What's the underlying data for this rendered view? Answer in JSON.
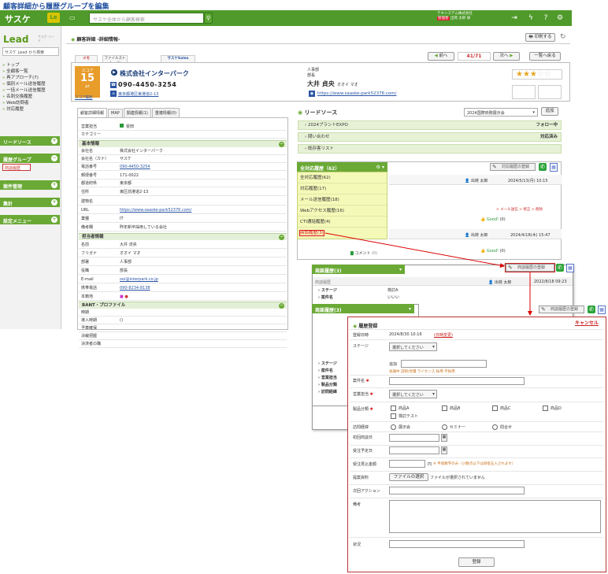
{
  "caption": "顧客詳細から履歴グループを編集",
  "topbar": {
    "app_name": "サスケ",
    "le_badge": "Le",
    "search_placeholder": "サスケ全体から顧客検索",
    "user_company": "テキシステム株式会社",
    "user_name": "出荷 太郎 様",
    "user_tag": "管理者"
  },
  "sidebar": {
    "lead_logo": "Lead",
    "lead_sub": "サスケ リード",
    "search_value": "サスケ Lead から検索",
    "nav": [
      "トップ",
      "全顧客一覧",
      "再アプローチ(7)",
      "個別メール送信履歴",
      "一括メール送信履歴",
      "名刺交換履歴",
      "Web訪問者",
      "対応履歴"
    ],
    "groups": [
      "リードソース",
      "履歴グループ",
      "案件管理",
      "集計",
      "顧客登録",
      "設定メニュー"
    ],
    "history_item": "商談履歴"
  },
  "main": {
    "title": "顧客詳細 -詳細情報-",
    "print_label": "印刷する",
    "tabs": [
      "メモ",
      "ファイルストレージ",
      "サスケSales"
    ],
    "prev_label": "前へ",
    "counter": "41/71",
    "next_label": "次へ",
    "back_label": "一覧へ戻る"
  },
  "card": {
    "score_label": "スコア",
    "score_value": "15",
    "score_unit": "pt",
    "score_link": "スコア履歴",
    "company": "株式会社インターパーク",
    "tel": "090-4450-3254",
    "address": "東京都港区東港道2-13",
    "dept": "人事部",
    "post": "部長",
    "person": "大井 貞央",
    "kana": "オオイ マオ",
    "url": "https://www.saaske-park52376.com/",
    "stars_filled": "★★★",
    "stars_empty": "☆☆"
  },
  "detail_tabs": [
    "顧客詳細情報",
    "MAP",
    "関連情報(1)",
    "重複情報(0)"
  ],
  "detail": {
    "rows_a": [
      {
        "k": "営業担当",
        "v": "受田"
      },
      {
        "k": "カテゴリー",
        "v": ""
      }
    ],
    "sec_basic": "基本情報",
    "rows_b": [
      {
        "k": "会社名",
        "v": "株式会社インターパーク"
      },
      {
        "k": "会社名（カナ）",
        "v": "サスケ"
      },
      {
        "k": "電話番号",
        "v": "090-4450-3254"
      },
      {
        "k": "郵便番号",
        "v": "171-0022"
      },
      {
        "k": "都道府県",
        "v": "東京都"
      },
      {
        "k": "住所",
        "v": "東区前港道2-13"
      },
      {
        "k": "建物名",
        "v": ""
      },
      {
        "k": "URL",
        "v": "https://www.saaske-park52376.com/"
      },
      {
        "k": "業種",
        "v": "IT"
      },
      {
        "k": "備考欄",
        "v": "昨年新卒採用している会社"
      }
    ],
    "sec_contact": "担当者情報",
    "rows_c": [
      {
        "k": "名前",
        "v": "大井 貞央"
      },
      {
        "k": "フリガナ",
        "v": "オオイ マオ"
      },
      {
        "k": "部署",
        "v": "人事部"
      },
      {
        "k": "役職",
        "v": "部長"
      },
      {
        "k": "E-mail",
        "v": "ooi@interpark.co.jp"
      },
      {
        "k": "携帯電話",
        "v": "090-8234-8138"
      },
      {
        "k": "本籍地",
        "v": ""
      }
    ],
    "sec_bant": "BANT・プロファイル",
    "rows_d": [
      {
        "k": "時期",
        "v": ""
      },
      {
        "k": "導入時期",
        "v": "()"
      },
      {
        "k": "予算確保",
        "v": ""
      },
      {
        "k": "決裁把握",
        "v": ""
      },
      {
        "k": "決済者の職",
        "v": ""
      }
    ]
  },
  "leads": {
    "title": "リードソース",
    "select_value": "2024国際商務展示会",
    "add_label": "追加",
    "rows": [
      {
        "name": "2024プラントEXPO",
        "status": "フォロー中"
      },
      {
        "name": "問い合わせ",
        "status": "対応済み"
      },
      {
        "name": "既存客リスト",
        "status": ""
      }
    ]
  },
  "history": {
    "group_label": "全対応履歴（62）",
    "menu": [
      "全対応履歴(62)",
      "対応履歴(17)",
      "メール送信履歴(18)",
      "Webアクセス履歴(16)",
      "CTI通話履歴(4)",
      "商談履歴(3)"
    ],
    "new_btn": "対応履歴の登録",
    "entry1_user": "出荷 太郎",
    "entry1_date": "2024/5/13(月) 10:15",
    "entry1_links": "> メール送信  > 修正  > 削除",
    "good": "Good!",
    "good_count": "(0)",
    "entry2_date": "2024/4/18(木) 15:47",
    "comment": "コメント",
    "comment_count": "(0)"
  },
  "popup1": {
    "header": "商談履歴(3)",
    "new_btn": "商談履歴の登録",
    "subhdr": "商談履歴",
    "user": "出荷 太郎",
    "date": "2022/8/18 09:23",
    "items": [
      {
        "k": "ステージ",
        "v": "検討A"
      },
      {
        "k": "案件名",
        "v": "いいい"
      },
      {
        "k": "営業担当",
        "v": ""
      },
      {
        "k": "製品分類",
        "v": ""
      },
      {
        "k": "訪問経緯",
        "v": ""
      }
    ]
  },
  "popup2": {
    "header": "商談履歴(3)",
    "new_btn": "商談履歴の登録",
    "items": [
      "ステージ",
      "案件名",
      "営業担当",
      "製品分類",
      "訪問経緯"
    ]
  },
  "form": {
    "title": "履歴登録",
    "cancel": "キャンセル",
    "date_label": "登録日時",
    "date_value": "2024/8/30 10:16",
    "date_change": "(日時変更)",
    "stage_label": "ステージ",
    "select_placeholder": "選択してください",
    "add_label": "追加",
    "stage_hint": "会議中 説明/見積 ライセンス 採用 不採用",
    "case_label": "案件名",
    "sales_label": "営業担当",
    "category_label": "製品分類",
    "category_opts": [
      "商品A",
      "商品B",
      "商品C",
      "商品D",
      "検討テスト"
    ],
    "visit_label": "訪問経緯",
    "visit_opts": [
      "展示会",
      "セミナー",
      "問合せ"
    ],
    "first_date_label": "初回商談日",
    "order_label": "受注予定日",
    "amount_label": "受注見込金額",
    "amount_unit": "円",
    "amount_note": "※ 半角数字のみ（小数点以下は四捨五入されます）",
    "file_label": "提案資料",
    "file_btn": "ファイルの選択",
    "file_none": "ファイルが選択されていません",
    "next_label": "次回アクション",
    "memo_label": "備考",
    "status_label": "状況",
    "submit": "登録"
  }
}
